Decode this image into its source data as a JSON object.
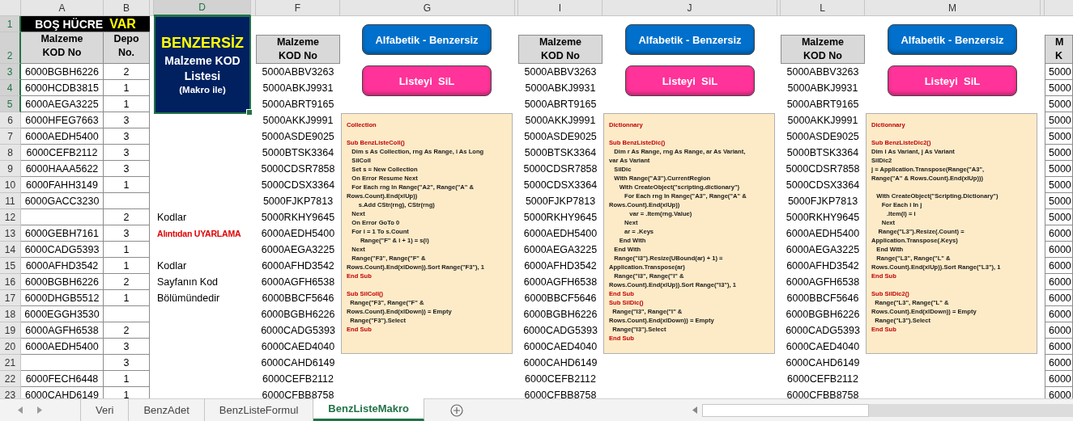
{
  "column_headers": [
    {
      "label": "A",
      "selected": false
    },
    {
      "label": "B",
      "selected": false
    },
    {
      "label": "D",
      "selected": true
    },
    {
      "label": "F",
      "selected": false
    },
    {
      "label": "G",
      "selected": false
    },
    {
      "label": "I",
      "selected": false
    },
    {
      "label": "J",
      "selected": false
    },
    {
      "label": "L",
      "selected": false
    },
    {
      "label": "M",
      "selected": false
    }
  ],
  "banner": {
    "label": "BOŞ HÜCRE",
    "flag": "VAR"
  },
  "headers": {
    "a": [
      "Malzeme",
      "KOD No"
    ],
    "b": [
      "Depo",
      "No."
    ],
    "f": [
      "Malzeme",
      "KOD No"
    ],
    "i": [
      "Malzeme",
      "KOD No"
    ],
    "l": [
      "Malzeme",
      "KOD No"
    ],
    "o": [
      "M",
      "K"
    ]
  },
  "rows": [
    {
      "number": "1",
      "selected": true
    },
    {
      "number": "2",
      "selected": true
    },
    {
      "number": "3",
      "selected": true,
      "a": "6000BGBH6226",
      "b": "2",
      "f": "5000ABBV3263",
      "i": "5000ABBV3263",
      "l": "5000ABBV3263",
      "o": "5000"
    },
    {
      "number": "4",
      "selected": true,
      "a": "6000HCDB3815",
      "b": "1",
      "f": "5000ABKJ9931",
      "i": "5000ABKJ9931",
      "l": "5000ABKJ9931",
      "o": "5000"
    },
    {
      "number": "5",
      "selected": true,
      "a": "6000AEGA3225",
      "b": "1",
      "f": "5000ABRT9165",
      "i": "5000ABRT9165",
      "l": "5000ABRT9165",
      "o": "5000"
    },
    {
      "number": "6",
      "selected": false,
      "a": "6000HFEG7663",
      "b": "3",
      "f": "5000AKKJ9991",
      "i": "5000AKKJ9991",
      "l": "5000AKKJ9991",
      "o": "5000"
    },
    {
      "number": "7",
      "selected": false,
      "a": "6000AEDH5400",
      "b": "3",
      "f": "5000ASDE9025",
      "i": "5000ASDE9025",
      "l": "5000ASDE9025",
      "o": "5000"
    },
    {
      "number": "8",
      "selected": false,
      "a": "6000CEFB2112",
      "b": "3",
      "f": "5000BTSK3364",
      "i": "5000BTSK3364",
      "l": "5000BTSK3364",
      "o": "5000"
    },
    {
      "number": "9",
      "selected": false,
      "a": "6000HAAA5622",
      "b": "3",
      "f": "5000CDSR7858",
      "i": "5000CDSR7858",
      "l": "5000CDSR7858",
      "o": "5000"
    },
    {
      "number": "10",
      "selected": false,
      "a": "6000FAHH3149",
      "b": "1",
      "f": "5000CDSX3364",
      "i": "5000CDSX3364",
      "l": "5000CDSX3364",
      "o": "5000"
    },
    {
      "number": "11",
      "selected": false,
      "a": "6000GACC3230",
      "f": "5000FJKP7813",
      "i": "5000FJKP7813",
      "l": "5000FJKP7813",
      "o": "5000"
    },
    {
      "number": "12",
      "selected": false,
      "b": "2",
      "d": {
        "text": "Kodlar",
        "kind": "note"
      },
      "f": "5000RKHY9645",
      "i": "5000RKHY9645",
      "l": "5000RKHY9645",
      "o": "5000"
    },
    {
      "number": "13",
      "selected": false,
      "a": "6000GEBH7161",
      "b": "3",
      "d": {
        "text": "Alıntıdan UYARLAMA",
        "kind": "alert"
      },
      "f": "6000AEDH5400",
      "i": "6000AEDH5400",
      "l": "6000AEDH5400",
      "o": "6000"
    },
    {
      "number": "14",
      "selected": false,
      "a": "6000CADG5393",
      "b": "1",
      "f": "6000AEGA3225",
      "i": "6000AEGA3225",
      "l": "6000AEGA3225",
      "o": "6000"
    },
    {
      "number": "15",
      "selected": false,
      "a": "6000AFHD3542",
      "b": "1",
      "d": {
        "text": "Kodlar",
        "kind": "note"
      },
      "f": "6000AFHD3542",
      "i": "6000AFHD3542",
      "l": "6000AFHD3542",
      "o": "6000"
    },
    {
      "number": "16",
      "selected": false,
      "a": "6000BGBH6226",
      "b": "2",
      "d": {
        "text": "Sayfanın Kod",
        "kind": "note"
      },
      "f": "6000AGFH6538",
      "i": "6000AGFH6538",
      "l": "6000AGFH6538",
      "o": "6000"
    },
    {
      "number": "17",
      "selected": false,
      "a": "6000DHGB5512",
      "b": "1",
      "d": {
        "text": "Bölümündedir",
        "kind": "note"
      },
      "f": "6000BBCF5646",
      "i": "6000BBCF5646",
      "l": "6000BBCF5646",
      "o": "6000"
    },
    {
      "number": "18",
      "selected": false,
      "a": "6000EGGH3530",
      "f": "6000BGBH6226",
      "i": "6000BGBH6226",
      "l": "6000BGBH6226",
      "o": "6000"
    },
    {
      "number": "19",
      "selected": false,
      "a": "6000AGFH6538",
      "b": "2",
      "f": "6000CADG5393",
      "i": "6000CADG5393",
      "l": "6000CADG5393",
      "o": "6000"
    },
    {
      "number": "20",
      "selected": false,
      "a": "6000AEDH5400",
      "b": "3",
      "f": "6000CAED4040",
      "i": "6000CAED4040",
      "l": "6000CAED4040",
      "o": "6000"
    },
    {
      "number": "21",
      "selected": false,
      "b": "3",
      "f": "6000CAHD6149",
      "i": "6000CAHD6149",
      "l": "6000CAHD6149",
      "o": "6000"
    },
    {
      "number": "22",
      "selected": false,
      "a": "6000FECH6448",
      "b": "1",
      "f": "6000CEFB2112",
      "i": "6000CEFB2112",
      "l": "6000CEFB2112",
      "o": "6000"
    },
    {
      "number": "23",
      "selected": false,
      "a": "6000CAHD6149",
      "b": "1",
      "f": "6000CFBB8758",
      "i": "6000CFBB8758",
      "l": "6000CFBB8758",
      "o": "6000"
    }
  ],
  "title_box": {
    "title": "BENZERSİZ",
    "lines": [
      "Malzeme KOD",
      "Listesi"
    ],
    "note": "(Makro ile)",
    "selected": true
  },
  "button_groups": [
    {
      "sort": "Alfabetik - Benzersiz",
      "clear": "Listeyi  SiL"
    },
    {
      "sort": "Alfabetik - Benzersiz",
      "clear": "Listeyi  SiL"
    },
    {
      "sort": "Alfabetik - Benzersiz",
      "clear": "Listeyi  SiL"
    }
  ],
  "code_boxes": [
    {
      "lines": [
        {
          "kind": "heading",
          "text": "Collection"
        },
        {
          "kind": "gap"
        },
        {
          "kind": "heading",
          "text": "Sub BenzListeColl()"
        },
        {
          "kind": "code",
          "text": "   Dim s As Collection, rng As Range, i As Long"
        },
        {
          "kind": "code",
          "text": "   SilColl"
        },
        {
          "kind": "code",
          "text": "   Set s = New Collection"
        },
        {
          "kind": "code",
          "text": "   On Error Resume Next"
        },
        {
          "kind": "code",
          "text": "   For Each rng In Range(\"A2\", Range(\"A\" &"
        },
        {
          "kind": "code",
          "text": "Rows.Count).End(xlUp))"
        },
        {
          "kind": "code",
          "text": "       s.Add CStr(rng), CStr(rng)"
        },
        {
          "kind": "code",
          "text": "   Next"
        },
        {
          "kind": "code",
          "text": "   On Error GoTo 0"
        },
        {
          "kind": "code",
          "text": "   For i = 1 To s.Count"
        },
        {
          "kind": "code",
          "text": "        Range(\"F\" & i + 1) = s(i)"
        },
        {
          "kind": "code",
          "text": "   Next"
        },
        {
          "kind": "code",
          "text": "   Range(\"F3\", Range(\"F\" &"
        },
        {
          "kind": "code",
          "text": "Rows.Count).End(xlDown)).Sort Range(\"F3\"), 1"
        },
        {
          "kind": "heading",
          "text": "End Sub"
        },
        {
          "kind": "gap"
        },
        {
          "kind": "heading",
          "text": "Sub SilColl()"
        },
        {
          "kind": "code",
          "text": "  Range(\"F3\", Range(\"F\" &"
        },
        {
          "kind": "code",
          "text": "Rows.Count).End(xlDown)) = Empty"
        },
        {
          "kind": "code",
          "text": "  Range(\"F3\").Select"
        },
        {
          "kind": "heading",
          "text": "End Sub"
        }
      ]
    },
    {
      "lines": [
        {
          "kind": "heading",
          "text": "Dictionnary"
        },
        {
          "kind": "gap"
        },
        {
          "kind": "heading",
          "text": "Sub BenzListeDic()"
        },
        {
          "kind": "code",
          "text": "   Dim r As Range, rng As Range, ar As Variant,"
        },
        {
          "kind": "code",
          "text": "var As Variant"
        },
        {
          "kind": "code",
          "text": "   SilDic"
        },
        {
          "kind": "code",
          "text": "   With Range(\"A3\").CurrentRegion"
        },
        {
          "kind": "code",
          "text": "      With CreateObject(\"scripting.dictionary\")"
        },
        {
          "kind": "code",
          "text": "         For Each rng In Range(\"A3\", Range(\"A\" &"
        },
        {
          "kind": "code",
          "text": "Rows.Count).End(xlUp))"
        },
        {
          "kind": "code",
          "text": "            var = .Item(rng.Value)"
        },
        {
          "kind": "code",
          "text": "         Next"
        },
        {
          "kind": "code",
          "text": "         ar = .Keys"
        },
        {
          "kind": "code",
          "text": "      End With"
        },
        {
          "kind": "code",
          "text": "   End With"
        },
        {
          "kind": "code",
          "text": "   Range(\"I3\").Resize(UBound(ar) + 1) ="
        },
        {
          "kind": "code",
          "text": "Application.Transpose(ar)"
        },
        {
          "kind": "code",
          "text": "   Range(\"I3\", Range(\"I\" &"
        },
        {
          "kind": "code",
          "text": "Rows.Count).End(xlUp)).Sort Range(\"I3\"), 1"
        },
        {
          "kind": "heading",
          "text": "End Sub"
        },
        {
          "kind": "heading",
          "text": "Sub SilDic()"
        },
        {
          "kind": "code",
          "text": "  Range(\"I3\", Range(\"I\" &"
        },
        {
          "kind": "code",
          "text": "Rows.Count).End(xlDown)) = Empty"
        },
        {
          "kind": "code",
          "text": "  Range(\"I3\").Select"
        },
        {
          "kind": "heading",
          "text": "End Sub"
        }
      ]
    },
    {
      "lines": [
        {
          "kind": "heading",
          "text": "Dictionnary"
        },
        {
          "kind": "gap"
        },
        {
          "kind": "heading",
          "text": "Sub BenzListeDic2()"
        },
        {
          "kind": "code",
          "text": "Dim i As Variant, j As Variant"
        },
        {
          "kind": "code",
          "text": "SilDic2"
        },
        {
          "kind": "code",
          "text": "j = Application.Transpose(Range(\"A3\","
        },
        {
          "kind": "code",
          "text": "Range(\"A\" & Rows.Count).End(xlUp)))"
        },
        {
          "kind": "gap"
        },
        {
          "kind": "code",
          "text": "   With CreateObject(\"Scripting.Dictionary\")"
        },
        {
          "kind": "code",
          "text": "      For Each i In j"
        },
        {
          "kind": "code",
          "text": "         .Item(i) = i"
        },
        {
          "kind": "code",
          "text": "      Next"
        },
        {
          "kind": "code",
          "text": "    Range(\"L3\").Resize(.Count) ="
        },
        {
          "kind": "code",
          "text": "Application.Transpose(.Keys)"
        },
        {
          "kind": "code",
          "text": "   End With"
        },
        {
          "kind": "code",
          "text": "   Range(\"L3\", Range(\"L\" &"
        },
        {
          "kind": "code",
          "text": "Rows.Count).End(xlUp)).Sort Range(\"L3\"), 1"
        },
        {
          "kind": "heading",
          "text": "End Sub"
        },
        {
          "kind": "gap"
        },
        {
          "kind": "heading",
          "text": "Sub SilDic2()"
        },
        {
          "kind": "code",
          "text": "  Range(\"L3\", Range(\"L\" &"
        },
        {
          "kind": "code",
          "text": "Rows.Count).End(xlDown)) = Empty"
        },
        {
          "kind": "code",
          "text": "  Range(\"L3\").Select"
        },
        {
          "kind": "heading",
          "text": "End Sub"
        }
      ]
    }
  ],
  "sheet_tabs": [
    {
      "label": "Veri",
      "selected": false
    },
    {
      "label": "BenzAdet",
      "selected": false
    },
    {
      "label": "BenzListeFormul",
      "selected": false
    },
    {
      "label": "BenzListeMakro",
      "selected": true
    }
  ]
}
